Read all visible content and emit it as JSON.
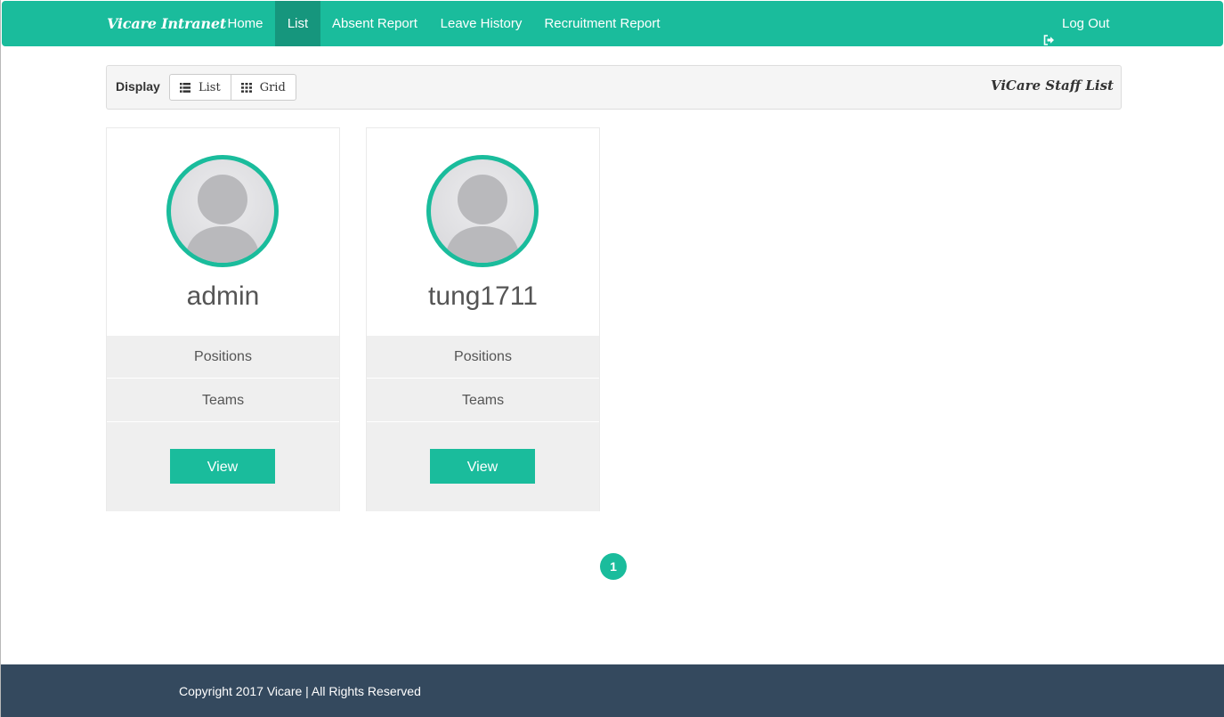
{
  "navbar": {
    "brand": "Vicare Intranet",
    "items": [
      {
        "label": "Home",
        "active": false
      },
      {
        "label": "List",
        "active": true
      },
      {
        "label": "Absent Report",
        "active": false
      },
      {
        "label": "Leave History",
        "active": false
      },
      {
        "label": "Recruitment Report",
        "active": false
      }
    ],
    "logout": {
      "label": "Log Out",
      "icon": "logout-icon"
    }
  },
  "toolbar": {
    "display_label": "Display",
    "buttons": [
      {
        "label": "List",
        "icon": "list-icon"
      },
      {
        "label": "Grid",
        "icon": "grid-icon"
      }
    ],
    "title": "ViCare Staff List"
  },
  "staff": [
    {
      "name": "admin",
      "positions_label": "Positions",
      "teams_label": "Teams",
      "view_label": "View"
    },
    {
      "name": "tung1711",
      "positions_label": "Positions",
      "teams_label": "Teams",
      "view_label": "View"
    }
  ],
  "pagination": {
    "current_page": "1"
  },
  "footer": {
    "text": "Copyright 2017 Vicare | All Rights Reserved"
  },
  "colors": {
    "accent": "#1abc9c",
    "accent_active": "#16967d",
    "footer_bg": "#34495e",
    "card_lower_bg": "#efefef"
  }
}
